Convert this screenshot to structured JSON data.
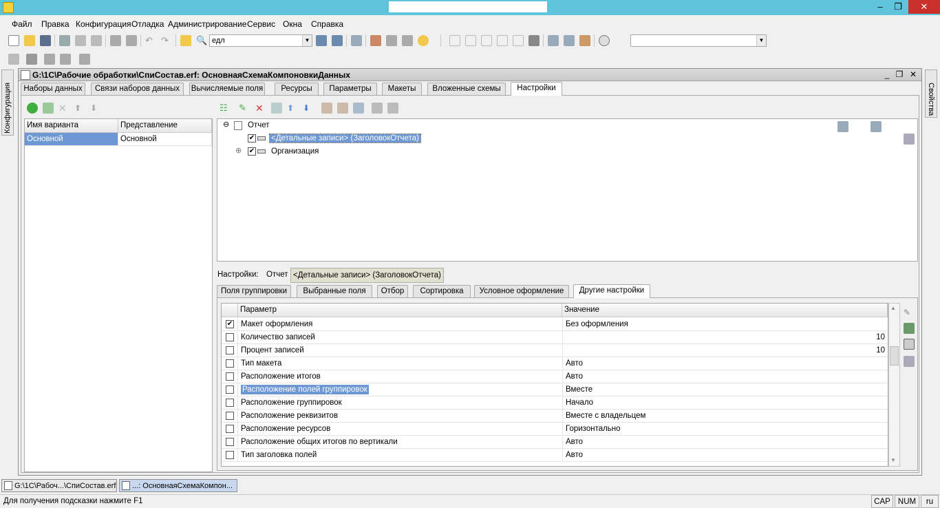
{
  "menu": [
    "Файл",
    "Правка",
    "Конфигурация",
    "Отладка",
    "Администрирование",
    "Сервис",
    "Окна",
    "Справка"
  ],
  "toolbar": {
    "search_value": "едл",
    "combo_value": ""
  },
  "side_left_label": "Конфигурация",
  "side_right_label": "Свойства",
  "window": {
    "title": "G:\\1C\\Рабочие обработки\\СпиСостав.erf: ОсновнаяСхемаКомпоновкиДанных",
    "min": "_",
    "restore": "❐",
    "close": "✕"
  },
  "main_tabs": [
    "Наборы данных",
    "Связи наборов данных",
    "Вычисляемые поля",
    "Ресурсы",
    "Параметры",
    "Макеты",
    "Вложенные схемы",
    "Настройки"
  ],
  "variants": {
    "headers": [
      "Имя варианта",
      "Представление"
    ],
    "rows": [
      [
        "Основной",
        "Основной"
      ]
    ]
  },
  "tree": {
    "root": "Отчет",
    "expander_root": "⊖",
    "expander_org": "⊕",
    "check": "✔",
    "items": [
      "<Детальные записи> (ЗаголовокОтчета)",
      "Организация"
    ]
  },
  "settings_line": {
    "label": "Настройки:",
    "root": "Отчет",
    "path": "<Детальные записи> (ЗаголовокОтчета)"
  },
  "settings_tabs": [
    "Поля группировки",
    "Выбранные поля",
    "Отбор",
    "Сортировка",
    "Условное оформление",
    "Другие настройки"
  ],
  "params": {
    "headers": [
      "Параметр",
      "Значение"
    ],
    "check": "✔",
    "rows": [
      {
        "name": "Макет оформления",
        "value": "Без оформления",
        "checked": true,
        "align": "left"
      },
      {
        "name": "Количество записей",
        "value": "10",
        "checked": false,
        "align": "right"
      },
      {
        "name": "Процент записей",
        "value": "10",
        "checked": false,
        "align": "right"
      },
      {
        "name": "Тип макета",
        "value": "Авто",
        "checked": false,
        "align": "left"
      },
      {
        "name": "Расположение итогов",
        "value": "Авто",
        "checked": false,
        "align": "left"
      },
      {
        "name": "Расположение полей группировок",
        "value": "Вместе",
        "checked": false,
        "align": "left",
        "selected": true
      },
      {
        "name": "Расположение группировок",
        "value": "Начало",
        "checked": false,
        "align": "left"
      },
      {
        "name": "Расположение реквизитов",
        "value": "Вместе с владельцем",
        "checked": false,
        "align": "left"
      },
      {
        "name": "Расположение ресурсов",
        "value": "Горизонтально",
        "checked": false,
        "align": "left"
      },
      {
        "name": "Расположение общих итогов по вертикали",
        "value": "Авто",
        "checked": false,
        "align": "left"
      },
      {
        "name": "Тип заголовка полей",
        "value": "Авто",
        "checked": false,
        "align": "left"
      }
    ]
  },
  "taskbar": [
    "G:\\1C\\Рабоч...\\СпиСостав.erf",
    "...: ОсновнаяСхемаКомпон..."
  ],
  "status": {
    "hint": "Для получения подсказки нажмите F1",
    "cap": "CAP",
    "num": "NUM",
    "lang": "ru"
  },
  "colors": {
    "titlebar": "#5ec4dc",
    "selection": "#6d98d3",
    "close": "#c9302c"
  }
}
